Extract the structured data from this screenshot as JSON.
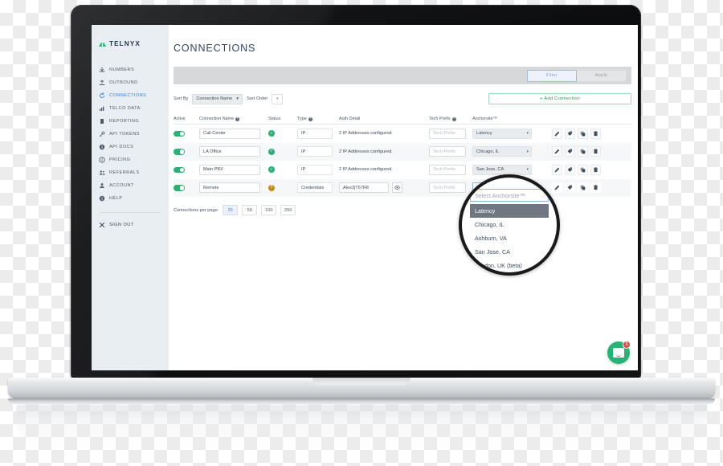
{
  "brand": {
    "name": "TELNYX",
    "green": "#22b573",
    "navy": "#1f3350",
    "accent_blue": "#2f7fe0"
  },
  "sidebar": {
    "items": [
      {
        "label": "NUMBERS",
        "icon": "download-icon",
        "active": false
      },
      {
        "label": "OUTBOUND",
        "icon": "upload-icon",
        "active": false
      },
      {
        "label": "CONNECTIONS",
        "icon": "sync-icon",
        "active": true
      },
      {
        "label": "TELCO DATA",
        "icon": "bar-chart-icon",
        "active": false
      },
      {
        "label": "REPORTING",
        "icon": "document-icon",
        "active": false
      },
      {
        "label": "API TOKENS",
        "icon": "key-icon",
        "active": false
      },
      {
        "label": "API DOCS",
        "icon": "info-icon",
        "active": false
      },
      {
        "label": "PRICING",
        "icon": "info-icon",
        "active": false
      },
      {
        "label": "REFERRALS",
        "icon": "people-icon",
        "active": false
      },
      {
        "label": "ACCOUNT",
        "icon": "person-icon",
        "active": false
      },
      {
        "label": "HELP",
        "icon": "info-icon",
        "active": false
      }
    ],
    "sign_out": {
      "label": "SIGN OUT",
      "icon": "close-x-icon"
    }
  },
  "main": {
    "page_title": "CONNECTIONS",
    "filter_bar": {
      "filter_label": "Filter",
      "apply_label": "Apply"
    },
    "sort_bar": {
      "sort_by_label": "Sort By",
      "sort_by_value": "Connection Name",
      "sort_order_label": "Sort Order",
      "add_connection_label": "+ Add Connection"
    },
    "table": {
      "headers": [
        {
          "label": "Active",
          "info": false
        },
        {
          "label": "Connection Name",
          "info": true
        },
        {
          "label": "Status",
          "info": false
        },
        {
          "label": "Type",
          "info": true
        },
        {
          "label": "Auth Detail",
          "info": false
        },
        {
          "label": "Tech Prefix",
          "info": true
        },
        {
          "label": "Anchorsite™",
          "info": false
        },
        {
          "label": "",
          "info": false
        }
      ],
      "prefix_placeholder": "Tech Prefix",
      "action_icons": [
        "edit-pencil-icon",
        "tag-icon",
        "duplicate-icon",
        "trash-icon"
      ],
      "rows": [
        {
          "active": true,
          "name": "Call Center",
          "status": "ok",
          "type": "IP",
          "auth_detail": "2 IP Addresses configured.",
          "has_eye": false,
          "tech_prefix": "",
          "anchorsite": "Latency"
        },
        {
          "active": true,
          "name": "LA Office",
          "status": "ok",
          "type": "IP",
          "auth_detail": "2 IP Addresses configured.",
          "has_eye": false,
          "tech_prefix": "",
          "anchorsite": "Chicago, IL"
        },
        {
          "active": true,
          "name": "Main PBX",
          "status": "ok",
          "type": "IP",
          "auth_detail": "2 IP Addresses configured.",
          "has_eye": false,
          "tech_prefix": "",
          "anchorsite": "San Jose, CA"
        },
        {
          "active": true,
          "name": "Remote",
          "status": "warn",
          "type": "Credentials",
          "auth_detail": "Alex3jT67R8",
          "has_eye": true,
          "tech_prefix": "",
          "anchorsite": ""
        }
      ]
    },
    "pagination": {
      "label": "Connections per page:",
      "options": [
        "25",
        "50",
        "100",
        "250"
      ],
      "selected": "25"
    }
  },
  "magnifier": {
    "search_placeholder": "Select Anchorsite™",
    "options": [
      {
        "label": "Latency",
        "highlighted": true
      },
      {
        "label": "Chicago, IL",
        "highlighted": false
      },
      {
        "label": "Ashburn, VA",
        "highlighted": false
      },
      {
        "label": "San Jose, CA",
        "highlighted": false
      },
      {
        "label": "London, UK (beta)",
        "highlighted": false
      }
    ]
  },
  "chat_widget": {
    "icon": "chat-bubble-icon",
    "badge_count": "1"
  }
}
